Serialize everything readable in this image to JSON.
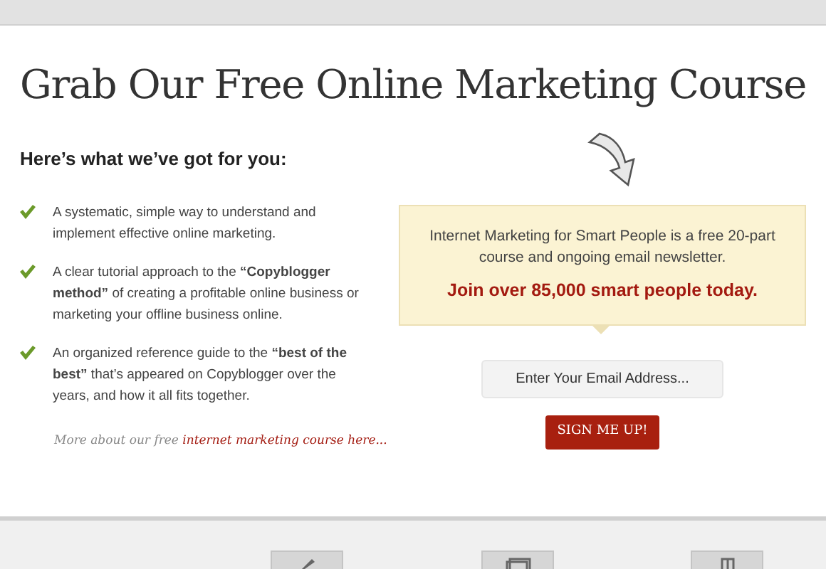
{
  "title": "Grab Our Free Online Marketing Course",
  "heading": "Here’s what we’ve got for you:",
  "features": [
    {
      "text": "A systematic, simple way to understand and implement effective online marketing.",
      "checked": true
    },
    {
      "text": "A clear tutorial approach to the **“Copyblogger method”** of creating a profitable online business or marketing your offline business online.",
      "checked": true
    },
    {
      "text": "An organized reference guide to the **“best of the best”** that’s appeared on Copyblogger over the years, and how it all fits together.",
      "checked": true
    }
  ],
  "more": {
    "prefix": "More about our free",
    "link": "internet marketing course here..."
  },
  "offer": {
    "text": "Internet Marketing for Smart People is a free 20-part course and ongoing email newsletter.",
    "highlight": "Join over 85,000 smart people today."
  },
  "email": {
    "placeholder": "Enter Your Email Address..."
  },
  "submit": "SIGN ME UP!"
}
